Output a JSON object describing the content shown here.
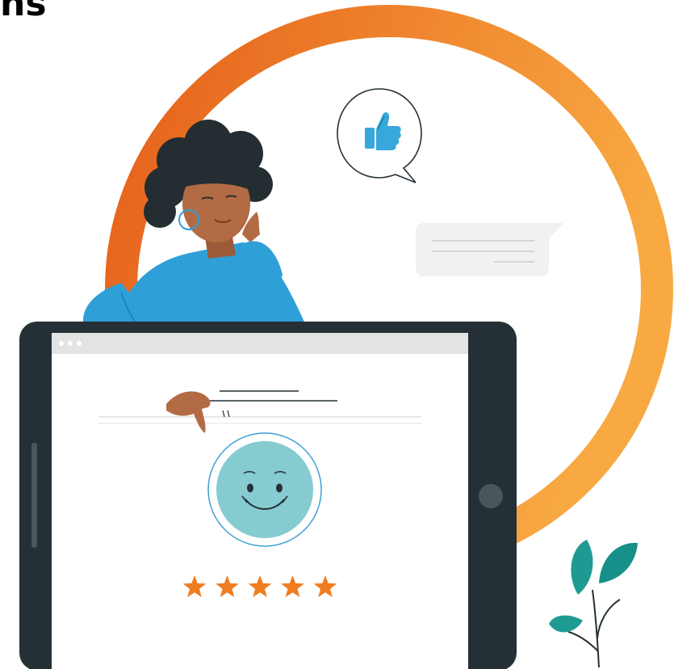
{
  "heading": {
    "text": "ns"
  },
  "rating": {
    "value": 5,
    "max": 5
  },
  "feedback_icon": "thumbs-up-icon",
  "colors": {
    "ring_start": "#e8671a",
    "ring_end": "#f7a43d",
    "tablet_frame": "#253036",
    "screen": "#ffffff",
    "browser_bar": "#e3e3e3",
    "face": "#85cbd0",
    "star": "#ef7d22",
    "sweater": "#2f9fd8",
    "skin": "#b36b44",
    "hair": "#232d32",
    "leaf": "#1f9a93",
    "thumb": "#36a8db"
  }
}
